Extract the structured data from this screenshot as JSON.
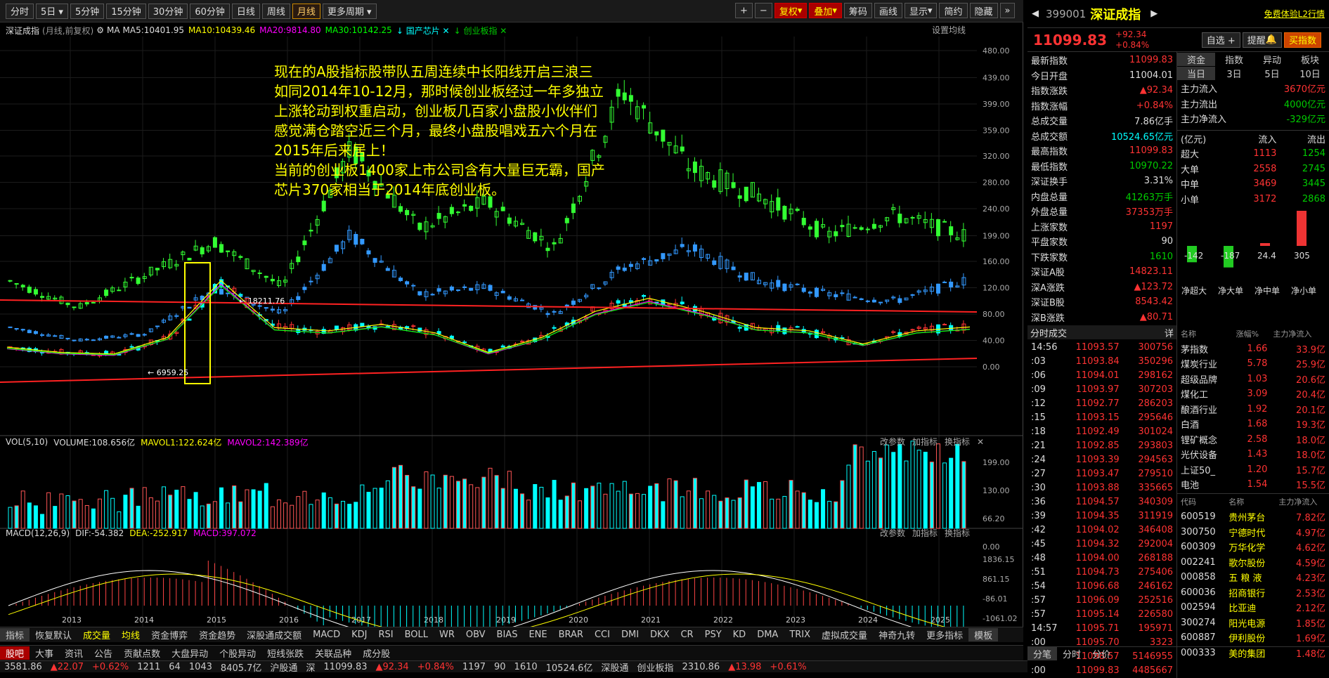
{
  "toolbar": {
    "periods": [
      "分时",
      "5日",
      "5分钟",
      "15分钟",
      "30分钟",
      "60分钟",
      "日线",
      "周线",
      "月线",
      "更多周期"
    ],
    "active_period": "月线",
    "right_buttons": [
      "复权",
      "叠加",
      "筹码",
      "画线",
      "显示",
      "简约",
      "隐藏"
    ]
  },
  "chart": {
    "index_name": "深证成指",
    "adj_note": "(月线,前复权)",
    "ma_label": "MA",
    "ma5": "MA5:10401.95",
    "ma10": "MA10:10439.46",
    "ma20": "MA20:9814.80",
    "ma30": "MA30:10142.25",
    "overlay1": "国产芯片",
    "overlay2": "创业板指",
    "settings": "设置均线",
    "annotation_high": "18211.76",
    "annotation_low": "6959.25",
    "note_lines": [
      "现在的A股指标股带队五周连续中长阳线开启三浪三",
      "如同2014年10-12月，那时候创业板经过一年多独立",
      "上涨轮动到权重启动，创业板几百家小盘股小伙伴们",
      "感觉满仓踏空近三个月，最终小盘股唱戏五六个月在",
      "2015年后来居上！",
      "当前的创业板1400家上市公司含有大量巨无霸，国产",
      "芯片370家相当于2014年底创业板。"
    ],
    "y_axis_main": [
      "480.00",
      "439.00",
      "399.00",
      "359.00",
      "320.00",
      "280.00",
      "240.00",
      "199.00",
      "160.00",
      "120.00",
      "80.00",
      "40.00",
      "0.00"
    ],
    "y_axis_vol": [
      "199.00",
      "130.00",
      "66.20",
      "0.00"
    ],
    "y_axis_macd": [
      "1836.15",
      "861.15",
      "-86.01",
      "-1061.02"
    ],
    "x_axis_years": [
      "2013",
      "2014",
      "2015",
      "2016",
      "2017",
      "2018",
      "2019",
      "2020",
      "2021",
      "2022",
      "2023",
      "2024",
      "2025"
    ],
    "vol_info": {
      "name": "VOL(5,10)",
      "volume": "VOLUME:108.656亿",
      "mavol1": "MAVOL1:122.624亿",
      "mavol2": "MAVOL2:142.389亿"
    },
    "macd_info": {
      "name": "MACD(12,26,9)",
      "dif": "DIF:-54.382",
      "dea": "DEA:-252.917",
      "macd": "MACD:397.072"
    },
    "sub_buttons": [
      "改参数",
      "加指标",
      "换指标"
    ]
  },
  "chart_data": {
    "type": "candlestick",
    "title": "深证成指 (月线,前复权)",
    "x": [
      "2013",
      "2014",
      "2015",
      "2016",
      "2017",
      "2018",
      "2019",
      "2020",
      "2021",
      "2022",
      "2023",
      "2024",
      "2025"
    ],
    "series": [
      {
        "name": "深证成指",
        "approx_close_path": [
          8000,
          7200,
          6959.25,
          9500,
          18211.76,
          11000,
          10500,
          11500,
          10200,
          7200,
          9500,
          13500,
          15500,
          13500,
          11000,
          10500,
          8500,
          10500,
          11099.83
        ]
      },
      {
        "name": "国产芯片",
        "approx_path": [
          130,
          90,
          140,
          190,
          120,
          330,
          210,
          250,
          180,
          420,
          300,
          260,
          200,
          230,
          200
        ]
      },
      {
        "name": "创业板指",
        "approx_path": [
          60,
          40,
          50,
          120,
          80,
          200,
          110,
          120,
          80,
          150,
          180,
          130,
          110,
          100,
          130
        ]
      }
    ],
    "ylim_overlay": [
      0,
      480
    ]
  },
  "bottom": {
    "tabs1": [
      "指标",
      "恢复默认",
      "成交量",
      "均线",
      "资金博弈",
      "资金趋势",
      "深股通成交额",
      "MACD",
      "KDJ",
      "RSI",
      "BOLL",
      "WR",
      "OBV",
      "BIAS",
      "ENE",
      "BRAR",
      "CCI",
      "DMI",
      "DKX",
      "CR",
      "PSY",
      "KD",
      "DMA",
      "TRIX",
      "虚拟成交量",
      "神奇九转",
      "更多指标",
      "模板"
    ],
    "tabs2": [
      "股吧",
      "大事",
      "资讯",
      "公告",
      "贡献点数",
      "大盘异动",
      "个股异动",
      "短线张跌",
      "关联品种",
      "成分股"
    ],
    "ticker": [
      "3581.86",
      "▲22.07",
      "+0.62%",
      "1211",
      "64",
      "1043",
      "8405.7亿",
      "沪股通",
      "深",
      "11099.83",
      "▲92.34",
      "+0.84%",
      "1197",
      "90",
      "1610",
      "10524.6亿",
      "深股通",
      "创业板指",
      "2310.86",
      "▲13.98",
      "+0.61%"
    ]
  },
  "right": {
    "code": "399001",
    "name": "深证成指",
    "trial": "免费体验L2行情",
    "price": "11099.83",
    "change": "+92.34",
    "pct": "+0.84%",
    "btn_select": "自选 +",
    "btn_remind": "提醒",
    "btn_buy": "买指数",
    "stats": [
      [
        "最新指数",
        "11099.83",
        "red"
      ],
      [
        "今日开盘",
        "11004.01",
        "wht"
      ],
      [
        "指数涨跌",
        "▲92.34",
        "red"
      ],
      [
        "指数涨幅",
        "+0.84%",
        "red"
      ],
      [
        "总成交量",
        "7.86亿手",
        "wht"
      ],
      [
        "总成交额",
        "10524.65亿元",
        "cyn"
      ],
      [
        "最高指数",
        "11099.83",
        "red"
      ],
      [
        "最低指数",
        "10970.22",
        "grn"
      ],
      [
        "深证换手",
        "3.31%",
        "wht"
      ],
      [
        "内盘总量",
        "41263万手",
        "grn"
      ],
      [
        "外盘总量",
        "37353万手",
        "red"
      ],
      [
        "上涨家数",
        "1197",
        "red"
      ],
      [
        "平盘家数",
        "90",
        "wht"
      ],
      [
        "下跌家数",
        "1610",
        "grn"
      ],
      [
        "深证A股",
        "14823.11",
        "red"
      ],
      [
        "深A涨跌",
        "▲123.72",
        "red"
      ],
      [
        "深证B股",
        "8543.42",
        "red"
      ],
      [
        "深B涨跌",
        "▲80.71",
        "red"
      ]
    ],
    "fund_tabs": [
      "资金",
      "指数",
      "异动",
      "板块"
    ],
    "fund_subtabs": [
      "当日",
      "3日",
      "5日",
      "10日"
    ],
    "fund_rows": [
      [
        "主力流入",
        "3670亿元",
        "red"
      ],
      [
        "主力流出",
        "4000亿元",
        "grn"
      ],
      [
        "主力净流入",
        "-329亿元",
        "grn"
      ]
    ],
    "flow_header": [
      "(亿元)",
      "流入",
      "流出"
    ],
    "flow_rows": [
      [
        "超大",
        "1113",
        "1254"
      ],
      [
        "大单",
        "2558",
        "2745"
      ],
      [
        "中单",
        "3469",
        "3445"
      ],
      [
        "小单",
        "3172",
        "2868"
      ]
    ],
    "net_bars": [
      {
        "label": "净超大",
        "value": -142
      },
      {
        "label": "净大单",
        "value": -187
      },
      {
        "label": "净中单",
        "value": 24.4
      },
      {
        "label": "净小单",
        "value": 305
      }
    ],
    "trades_title": "分时成交",
    "trades_more": "详",
    "trades": [
      [
        "14:56",
        "11093.57",
        "300756"
      ],
      [
        ":03",
        "11093.84",
        "350296"
      ],
      [
        ":06",
        "11094.01",
        "298162"
      ],
      [
        ":09",
        "11093.97",
        "307203"
      ],
      [
        ":12",
        "11092.77",
        "286203"
      ],
      [
        ":15",
        "11093.15",
        "295646"
      ],
      [
        ":18",
        "11092.49",
        "301024"
      ],
      [
        ":21",
        "11092.85",
        "293803"
      ],
      [
        ":24",
        "11093.39",
        "294563"
      ],
      [
        ":27",
        "11093.47",
        "279510"
      ],
      [
        ":30",
        "11093.88",
        "335665"
      ],
      [
        ":36",
        "11094.57",
        "340309"
      ],
      [
        ":39",
        "11094.35",
        "311919"
      ],
      [
        ":42",
        "11094.02",
        "346408"
      ],
      [
        ":45",
        "11094.32",
        "292004"
      ],
      [
        ":48",
        "11094.00",
        "268188"
      ],
      [
        ":51",
        "11094.73",
        "275406"
      ],
      [
        ":54",
        "11096.68",
        "246162"
      ],
      [
        ":57",
        "11096.09",
        "252516"
      ],
      [
        ":57",
        "11095.14",
        "226580"
      ],
      [
        "14:57",
        "11095.71",
        "195971"
      ],
      [
        ":00",
        "11095.70",
        "3323"
      ],
      [
        "15:00",
        "11098.57",
        "5146955"
      ],
      [
        ":00",
        "11099.83",
        "4485667"
      ]
    ],
    "sector_header": [
      "名称",
      "涨幅%",
      "主力净流入"
    ],
    "sectors": [
      [
        "茅指数",
        "1.66",
        "33.9亿"
      ],
      [
        "煤炭行业",
        "5.78",
        "25.9亿"
      ],
      [
        "超级品牌",
        "1.03",
        "20.6亿"
      ],
      [
        "煤化工",
        "3.09",
        "20.4亿"
      ],
      [
        "酿酒行业",
        "1.92",
        "20.1亿"
      ],
      [
        "白酒",
        "1.68",
        "19.3亿"
      ],
      [
        "锂矿概念",
        "2.58",
        "18.0亿"
      ],
      [
        "光伏设备",
        "1.43",
        "18.0亿"
      ],
      [
        "上证50_",
        "1.20",
        "15.7亿"
      ],
      [
        "电池",
        "1.54",
        "15.5亿"
      ]
    ],
    "stock_header": [
      "代码",
      "名称",
      "主力净流入"
    ],
    "stocks": [
      [
        "600519",
        "贵州茅台",
        "7.82亿"
      ],
      [
        "300750",
        "宁德时代",
        "4.97亿"
      ],
      [
        "600309",
        "万华化学",
        "4.62亿"
      ],
      [
        "002241",
        "歌尔股份",
        "4.59亿"
      ],
      [
        "000858",
        "五 粮 液",
        "4.23亿"
      ],
      [
        "600036",
        "招商银行",
        "2.53亿"
      ],
      [
        "002594",
        "比亚迪",
        "2.12亿"
      ],
      [
        "300274",
        "阳光电源",
        "1.85亿"
      ],
      [
        "600887",
        "伊利股份",
        "1.69亿"
      ],
      [
        "000333",
        "美的集团",
        "1.48亿"
      ]
    ],
    "bottom_tabs": [
      "分笔",
      "分时",
      "分价"
    ]
  }
}
